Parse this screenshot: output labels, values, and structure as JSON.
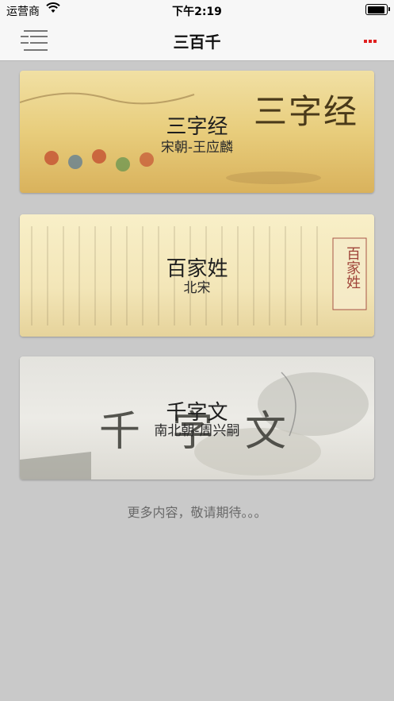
{
  "status_bar": {
    "carrier": "运营商",
    "time": "下午2:19"
  },
  "nav": {
    "title": "三百千"
  },
  "cards": [
    {
      "title": "三字经",
      "subtitle": "宋朝-王应麟",
      "deco": "三字经"
    },
    {
      "title": "百家姓",
      "subtitle": "北宋",
      "deco": "百家姓"
    },
    {
      "title": "千字文",
      "subtitle": "南北朝-周兴嗣",
      "deco": "千字文"
    }
  ],
  "footer": {
    "text": "更多内容，敬请期待。。。"
  },
  "colors": {
    "background": "#c9c9c9",
    "nav_bar": "#f7f7f7",
    "more_dots": "#e02020"
  }
}
